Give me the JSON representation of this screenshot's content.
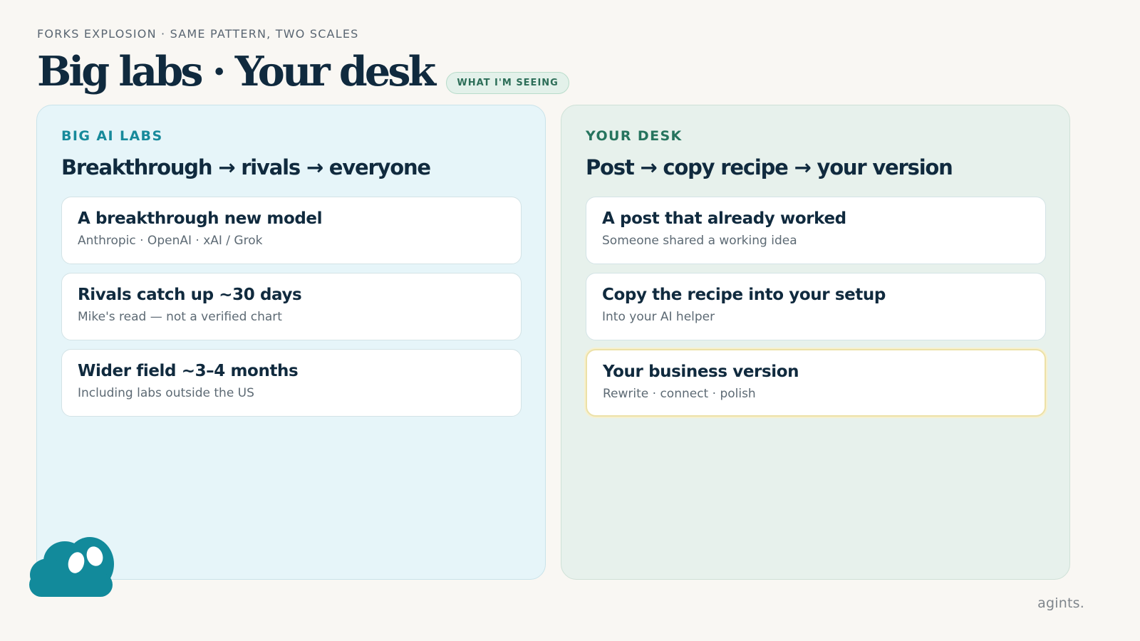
{
  "header": {
    "eyebrow": "FORKS EXPLOSION · SAME PATTERN, TWO SCALES",
    "title": "Big labs · Your desk",
    "badge": "WHAT I'M SEEING"
  },
  "panels": {
    "left": {
      "label": "BIG AI LABS",
      "heading": "Breakthrough → rivals → everyone",
      "cards": [
        {
          "title": "A breakthrough new model",
          "subtitle": "Anthropic · OpenAI · xAI / Grok"
        },
        {
          "title": "Rivals catch up ~30 days",
          "subtitle": "Mike's read — not a verified chart"
        },
        {
          "title": "Wider field ~3–4 months",
          "subtitle": "Including labs outside the US"
        }
      ]
    },
    "right": {
      "label": "YOUR DESK",
      "heading": "Post → copy recipe → your version",
      "cards": [
        {
          "title": "A post that already worked",
          "subtitle": "Someone shared a working idea"
        },
        {
          "title": "Copy the recipe into your setup",
          "subtitle": "Into your AI helper"
        },
        {
          "title": "Your business version",
          "subtitle": "Rewrite · connect · polish"
        }
      ]
    }
  },
  "footer": {
    "brand": "agints."
  },
  "icons": {
    "mascot": "cloud-mascot-icon"
  },
  "colors": {
    "teal_accent": "#178a9b",
    "green_accent": "#26745e",
    "highlight_border": "#ece1a8",
    "mascot": "#128a9b"
  }
}
